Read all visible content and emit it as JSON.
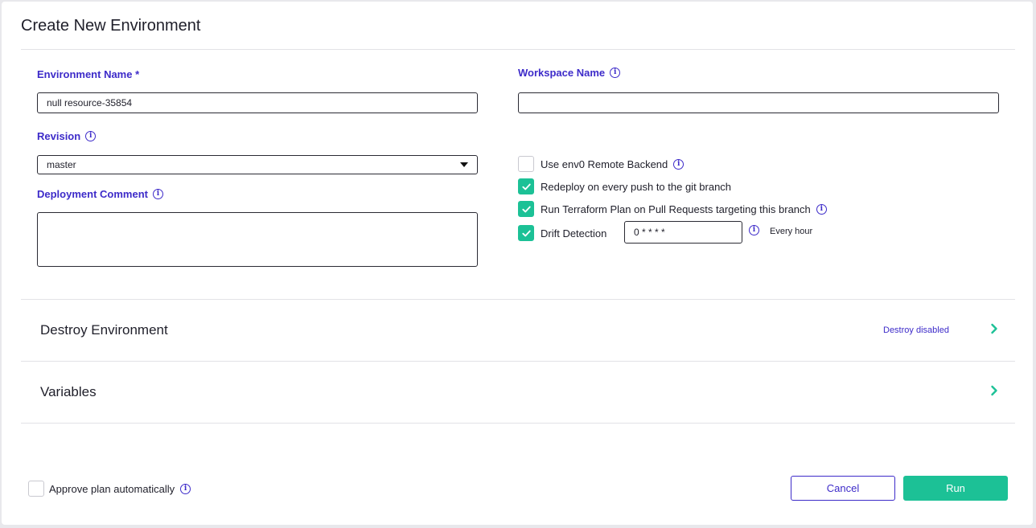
{
  "dialog": {
    "title": "Create New Environment"
  },
  "form": {
    "environment_name": {
      "label": "Environment Name *",
      "value": "null resource-35854"
    },
    "workspace_name": {
      "label": "Workspace Name",
      "value": ""
    },
    "revision": {
      "label": "Revision",
      "value": "master"
    },
    "deployment_comment": {
      "label": "Deployment Comment",
      "value": ""
    }
  },
  "options": {
    "remote_backend": {
      "label": "Use env0 Remote Backend",
      "checked": false
    },
    "redeploy": {
      "label": "Redeploy on every push to the git branch",
      "checked": true
    },
    "plan_on_pr": {
      "label": "Run Terraform Plan on Pull Requests targeting this branch",
      "checked": true
    },
    "drift_detection": {
      "label": "Drift Detection",
      "checked": true,
      "cron": "0 * * * *",
      "schedule_text": "Every hour"
    }
  },
  "sections": {
    "destroy": {
      "title": "Destroy Environment",
      "status": "Destroy disabled"
    },
    "variables": {
      "title": "Variables"
    }
  },
  "footer": {
    "approve_auto": {
      "label": "Approve plan automatically",
      "checked": false
    },
    "cancel_label": "Cancel",
    "run_label": "Run"
  },
  "icons": {
    "info": "info-icon",
    "check": "check-icon",
    "chevron": "chevron-right-icon",
    "caret": "caret-down-icon"
  },
  "colors": {
    "accent": "#3d2bc9",
    "success": "#1cc196"
  }
}
